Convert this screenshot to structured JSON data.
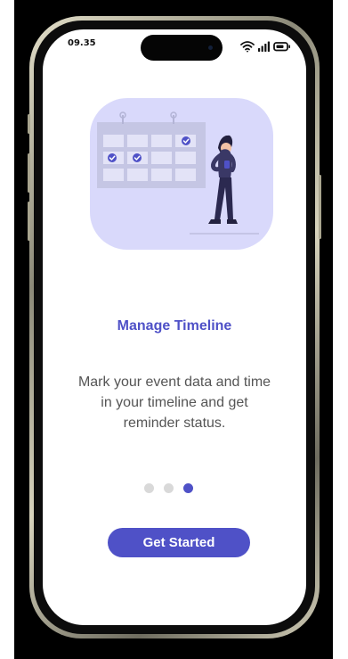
{
  "status_bar": {
    "time": "09.35",
    "icons": [
      "wifi-icon",
      "signal-icon",
      "battery-icon"
    ]
  },
  "onboarding": {
    "illustration": "calendar-person-illustration",
    "title": "Manage Timeline",
    "description": "Mark your event data and time in your timeline and get reminder status.",
    "page_count": 3,
    "active_page": 3,
    "cta_label": "Get Started"
  },
  "colors": {
    "accent": "#4f51c7",
    "illustration_bg": "#d9d9fb",
    "inactive_dot": "#d9d9d9",
    "text_muted": "#555555"
  }
}
